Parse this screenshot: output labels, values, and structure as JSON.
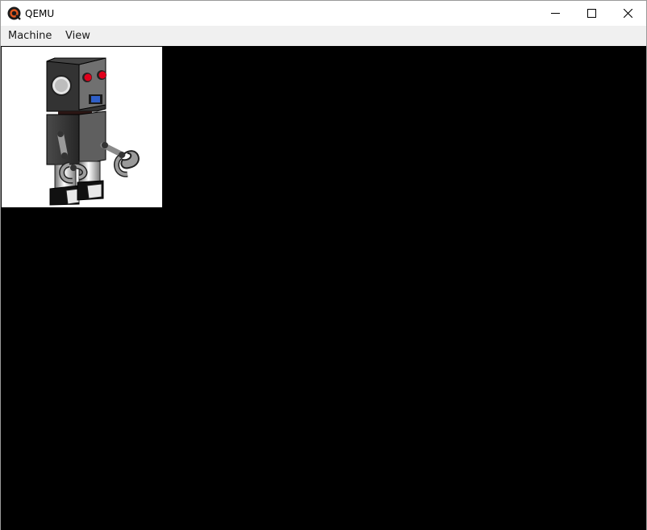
{
  "window": {
    "title": "QEMU",
    "icons": {
      "app": "qemu-logo-icon",
      "minimize": "minimize-icon",
      "maximize": "maximize-icon",
      "close": "close-icon"
    }
  },
  "menubar": {
    "items": [
      {
        "label": "Machine"
      },
      {
        "label": "View"
      }
    ]
  },
  "display": {
    "background": "#000000",
    "content": "robot-image"
  },
  "colors": {
    "accent": "#e2571e",
    "robot_eyes": "#e0001b",
    "robot_mouth": "#2f5fc7"
  }
}
